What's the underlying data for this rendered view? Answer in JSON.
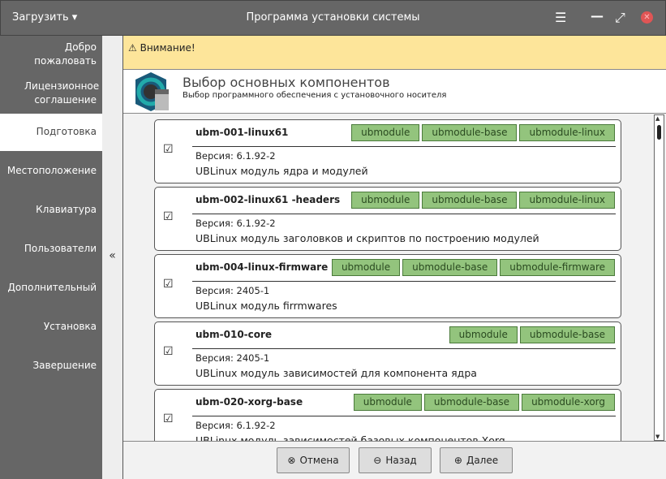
{
  "window": {
    "title": "Программа установки системы",
    "load_menu": "Загрузить ▾"
  },
  "sidebar": {
    "items": [
      {
        "label": "Добро пожаловать"
      },
      {
        "label": "Лицензионное соглашение"
      },
      {
        "label": "Подготовка"
      },
      {
        "label": "Местоположение"
      },
      {
        "label": "Клавиатура"
      },
      {
        "label": "Пользователи"
      },
      {
        "label": "Дополнительный"
      },
      {
        "label": "Установка"
      },
      {
        "label": "Завершение"
      }
    ],
    "collapse": "«"
  },
  "warning": {
    "text": "Внимание!"
  },
  "header": {
    "title": "Выбор основных компонентов",
    "subtitle": "Выбор программного обеспечения с установочного носителя"
  },
  "components": [
    {
      "name": "ubm-001-linux61",
      "version": "Версия: 6.1.92-2",
      "desc": "UBLinux модуль ядра и модулей",
      "tags": [
        "ubmodule",
        "ubmodule-base",
        "ubmodule-linux"
      ],
      "checked": true
    },
    {
      "name": "ubm-002-linux61 -headers",
      "version": "Версия: 6.1.92-2",
      "desc": "UBLinux модуль заголовков и скриптов по построению модулей",
      "tags": [
        "ubmodule",
        "ubmodule-base",
        "ubmodule-linux"
      ],
      "checked": true
    },
    {
      "name": "ubm-004-linux-firmware",
      "version": "Версия: 2405-1",
      "desc": "UBLinux модуль firrmwares",
      "tags": [
        "ubmodule",
        "ubmodule-base",
        "ubmodule-firmware"
      ],
      "checked": true
    },
    {
      "name": "ubm-010-core",
      "version": "Версия: 2405-1",
      "desc": "UBLinux модуль зависимостей для компонента ядра",
      "tags": [
        "ubmodule",
        "ubmodule-base"
      ],
      "checked": true
    },
    {
      "name": "ubm-020-xorg-base",
      "version": "Версия: 6.1.92-2",
      "desc": "UBLinux модуль зависимостей базовых компонентов Xorg",
      "tags": [
        "ubmodule",
        "ubmodule-base",
        "ubmodule-xorg"
      ],
      "checked": true
    }
  ],
  "buttons": {
    "cancel": "Отмена",
    "back": "Назад",
    "next": "Далее"
  }
}
